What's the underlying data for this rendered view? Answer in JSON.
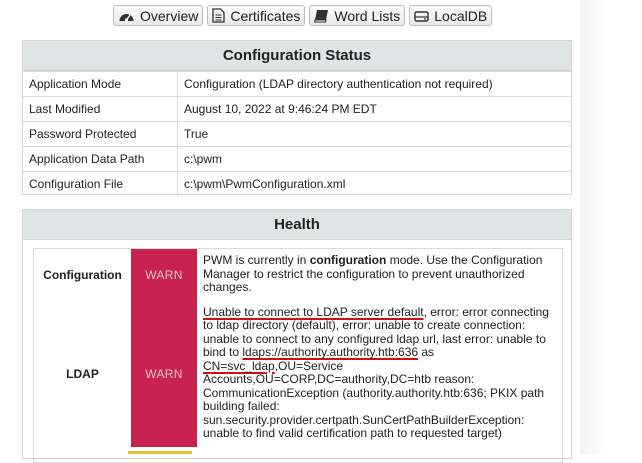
{
  "nav": {
    "overview": "Overview",
    "certificates": "Certificates",
    "word_lists": "Word Lists",
    "localdb": "LocalDB"
  },
  "config_status": {
    "title": "Configuration Status",
    "rows": [
      {
        "key": "Application Mode",
        "value": "Configuration (LDAP directory authentication not required)"
      },
      {
        "key": "Last Modified",
        "value": "August 10, 2022 at 9:46:24 PM EDT"
      },
      {
        "key": "Password Protected",
        "value": "True"
      },
      {
        "key": "Application Data Path",
        "value": "c:\\pwm"
      },
      {
        "key": "Configuration File",
        "value": "c:\\pwm\\PwmConfiguration.xml"
      }
    ]
  },
  "health": {
    "title": "Health",
    "items": [
      {
        "name": "Configuration",
        "status": "WARN",
        "msg_prefix": "PWM is currently in ",
        "msg_bold": "configuration",
        "msg_suffix": " mode. Use the Configuration Manager to restrict the configuration to prevent unauthorized changes."
      },
      {
        "name": "LDAP",
        "status": "WARN",
        "msg_part1": "Unable to connect to LDAP server default",
        "msg_part2": ", error: error connecting to ldap directory (default), error: unable to create connection: unable to connect to any configured ldap url, last error: unable to bind to ",
        "msg_part3": "ldaps://authority.authority.htb:636",
        "msg_part4": " as ",
        "msg_part5": "CN=svc_ldap",
        "msg_part6": ",OU=Service Accounts,OU=CORP,DC=authority,DC=htb reason: CommunicationException (authority.authority.htb:636; PKIX path building failed: sun.security.provider.certpath.SunCertPathBuilderException: unable to find valid certification path to requested target)"
      }
    ]
  },
  "colors": {
    "warn_bg": "#c8234c",
    "panel_header_bg": "#dfe4e4",
    "annotation_underline": "#d01010"
  }
}
